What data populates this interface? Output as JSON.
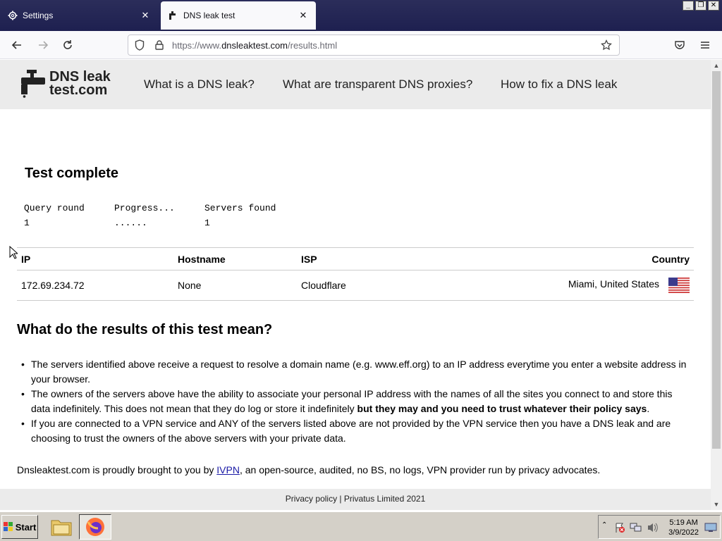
{
  "browser": {
    "tabs": [
      {
        "label": "Settings",
        "icon": "gear-icon"
      },
      {
        "label": "DNS leak test",
        "icon": "faucet-icon"
      }
    ],
    "url_prefix": "https://www.",
    "url_domain": "dnsleaktest.com",
    "url_path": "/results.html"
  },
  "site": {
    "logo_line1": "DNS leak",
    "logo_line2": "test.com",
    "nav": [
      "What is a DNS leak?",
      "What are transparent DNS proxies?",
      "How to fix a DNS leak"
    ]
  },
  "test": {
    "heading": "Test complete",
    "columns": [
      "Query round",
      "Progress...",
      "Servers found"
    ],
    "values": [
      "1",
      "......",
      "1"
    ]
  },
  "results": {
    "headers": [
      "IP",
      "Hostname",
      "ISP",
      "Country"
    ],
    "rows": [
      {
        "ip": "172.69.234.72",
        "hostname": "None",
        "isp": "Cloudflare",
        "country": "Miami, United States"
      }
    ]
  },
  "explain": {
    "heading": "What do the results of this test mean?",
    "bullet1": "The servers identified above receive a request to resolve a domain name (e.g. www.eff.org) to an IP address everytime you enter a website address in your browser.",
    "bullet2_a": "The owners of the servers above have the ability to associate your personal IP address with the names of all the sites you connect to and store this data indefinitely. This does not mean that they do log or store it indefinitely ",
    "bullet2_b": "but they may and you need to trust whatever their policy says",
    "bullet2_c": ".",
    "bullet3": "If you are connected to a VPN service and ANY of the servers listed above are not provided by the VPN service then you have a DNS leak and are choosing to trust the owners of the above servers with your private data."
  },
  "credit": {
    "before": "Dnsleaktest.com is proudly brought to you by ",
    "link": "IVPN",
    "after": ", an open-source, audited, no BS, no logs, VPN provider run by privacy advocates."
  },
  "footer": {
    "privacy": "Privacy policy",
    "sep": " | ",
    "company": "Privatus Limited 2021"
  },
  "taskbar": {
    "start": "Start",
    "time": "5:19 AM",
    "date": "3/9/2022"
  },
  "colors": {
    "link": "#1a1aa6",
    "header_bg": "#ebebeb",
    "tabstrip": "#1e2050"
  }
}
